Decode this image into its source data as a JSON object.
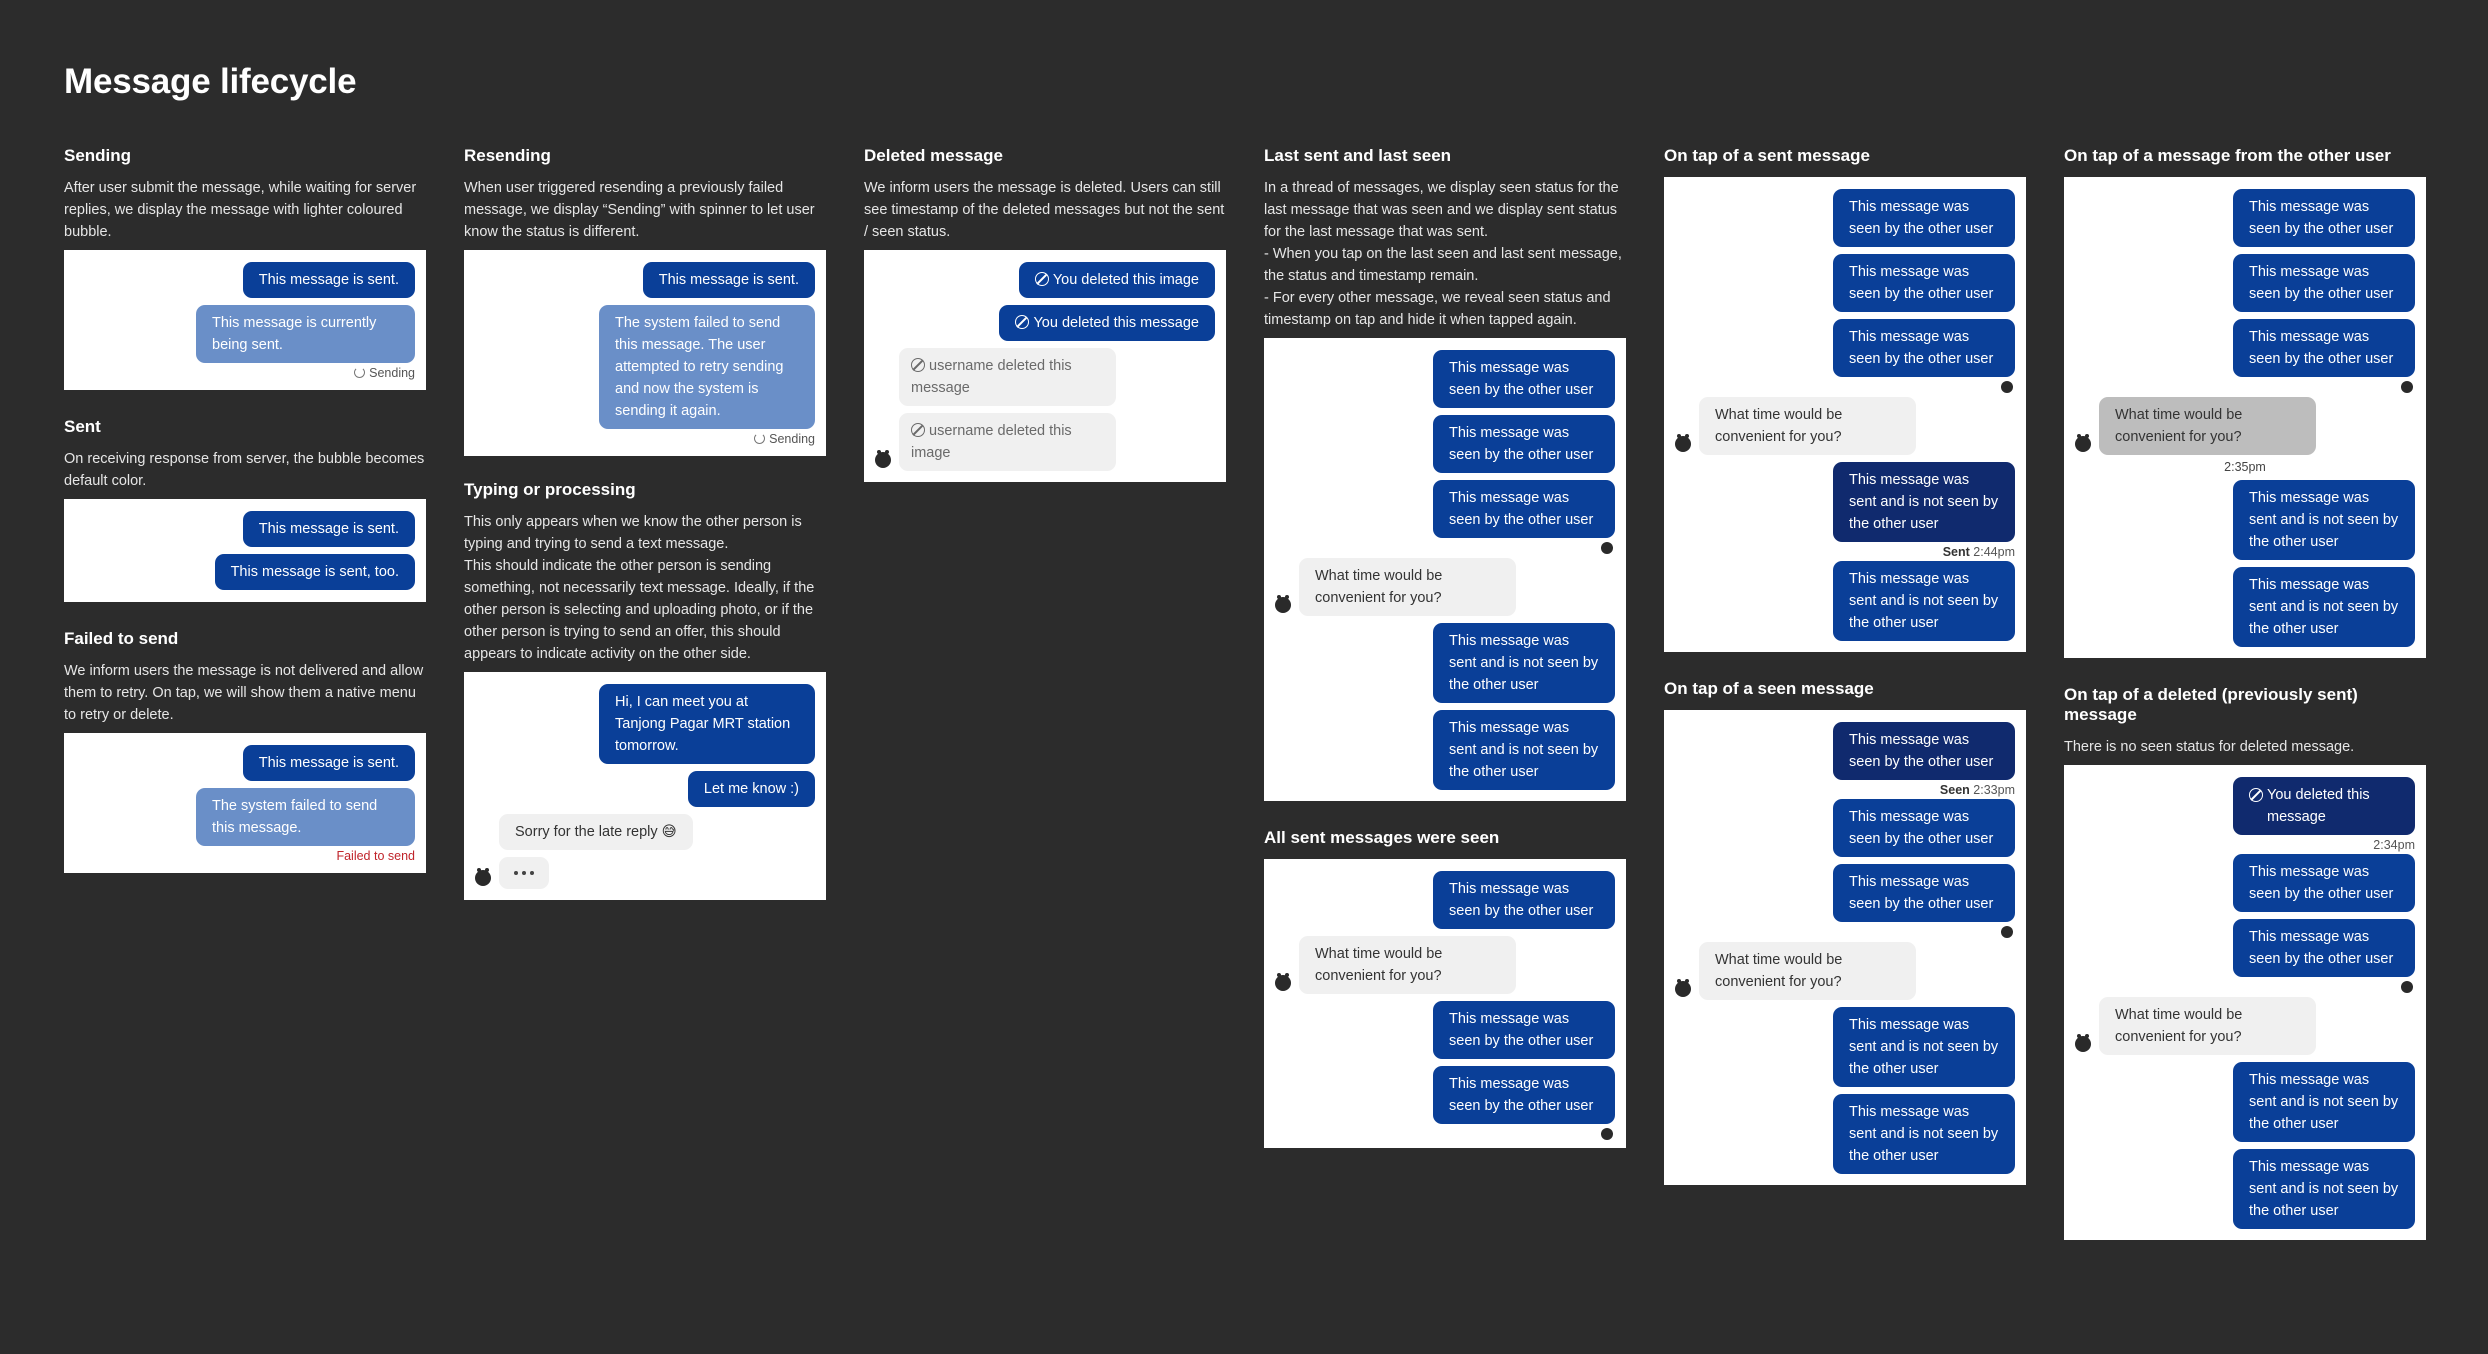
{
  "page_title": "Message lifecycle",
  "sending": {
    "title": "Sending",
    "desc": "After user submit the message, while waiting for server replies, we display the message with lighter coloured bubble.",
    "b1": "This message is sent.",
    "b2": "This message is currently being sent.",
    "status": "Sending"
  },
  "sent": {
    "title": "Sent",
    "desc": "On receiving response from server, the bubble becomes default color.",
    "b1": "This message is sent.",
    "b2": "This message is sent, too."
  },
  "failed": {
    "title": "Failed to send",
    "desc": "We inform users the message is not delivered and allow them to retry. On tap, we will show them a native menu to retry or delete.",
    "b1": "This message is sent.",
    "b2": "The system failed to send this message.",
    "status": "Failed to send"
  },
  "resending": {
    "title": "Resending",
    "desc": "When user triggered resending a previously failed message, we display “Sending” with spinner to let user know the status is different.",
    "b1": "This message is sent.",
    "b2": "The system failed to send this message. The user attempted to retry sending and now the system is sending it again.",
    "status": "Sending"
  },
  "typing": {
    "title": "Typing or processing",
    "desc": "This only appears when we know the other person is typing and trying to send a text message.\nThis should indicate the other person is sending something, not necessarily text message. Ideally, if the other person is selecting and uploading photo, or if the other person is trying to send an offer, this should appears to indicate activity on the other side.",
    "b1": "Hi, I can meet you at Tanjong Pagar MRT station tomorrow.",
    "b2": "Let me know :)",
    "b3": "Sorry for the late reply 😅"
  },
  "deleted": {
    "title": "Deleted message",
    "desc": "We inform users the message is deleted. Users can still see timestamp of the deleted messages but not the sent / seen status.",
    "b1": "You deleted this image",
    "b2": "You deleted this message",
    "b3": "username deleted this message",
    "b4": "username deleted this image"
  },
  "last_seen": {
    "title": "Last sent and last seen",
    "desc": "In a thread of messages, we display seen status  for the last message that was seen and we display sent status for the last message that was sent.\n- When you tap on the last seen and last sent message, the status and timestamp remain.\n- For every other message, we reveal seen status and timestamp on tap and hide it when tapped again.",
    "seen": "This message was seen by the other user",
    "question": "What time would be convenient for you?",
    "unseen": "This message was sent and is not seen by the other user"
  },
  "all_seen": {
    "title": "All sent messages were seen",
    "seen": "This message was seen by the other user",
    "question": "What time would be convenient for you?"
  },
  "tap_sent": {
    "title": "On tap of  a sent message",
    "seen": "This message was seen by the other user",
    "question": "What time would be convenient for you?",
    "unseen": "This message was sent and is not seen by the other user",
    "status_label": "Sent",
    "status_time": "2:44pm"
  },
  "tap_seen": {
    "title": "On tap of  a seen message",
    "seen": "This message was seen by the other user",
    "status_label": "Seen",
    "status_time": "2:33pm",
    "question": "What time would be convenient for you?",
    "unseen": "This message was sent and is not seen by the other user"
  },
  "tap_other": {
    "title": "On tap of  a message from the other user",
    "seen": "This message was seen by the other user",
    "question": "What time would be convenient for you?",
    "time": "2:35pm",
    "unseen": "This message was sent and is not seen by the other user"
  },
  "tap_deleted": {
    "title": "On tap of  a deleted (previously sent) message",
    "desc": "There is no seen status for deleted message.",
    "deleted": "You deleted this message",
    "time": "2:34pm",
    "seen": "This message was seen by the other user",
    "question": "What time would be convenient for you?",
    "unseen": "This message was sent and is not seen by the other user"
  },
  "colors": {
    "background": "#2c2c2c",
    "sent_bubble": "#0a3f98",
    "sending_bubble": "#6a8fc8",
    "focused_bubble": "#102a6e",
    "incoming_bubble": "#f0f0f0",
    "failed_text": "#c0242b"
  }
}
